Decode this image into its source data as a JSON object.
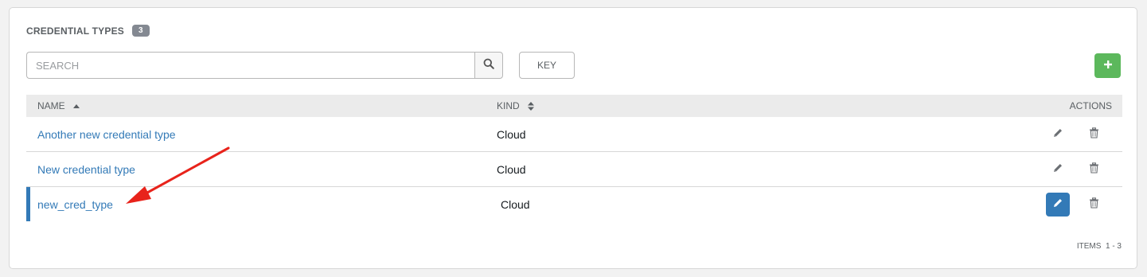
{
  "header": {
    "title": "CREDENTIAL TYPES",
    "count": "3"
  },
  "search": {
    "placeholder": "SEARCH",
    "value": ""
  },
  "toolbar": {
    "key_label": "KEY",
    "add_label": "+"
  },
  "table": {
    "columns": {
      "name": "NAME",
      "kind": "KIND",
      "actions": "ACTIONS"
    },
    "rows": [
      {
        "name": "Another new credential type",
        "kind": "Cloud",
        "selected": false
      },
      {
        "name": "New credential type",
        "kind": "Cloud",
        "selected": false
      },
      {
        "name": "new_cred_type",
        "kind": "Cloud",
        "selected": true
      }
    ]
  },
  "pagination": {
    "label": "ITEMS",
    "range": "1 - 3"
  },
  "colors": {
    "link": "#337ab7",
    "add_button": "#5cb85c",
    "selected_marker": "#337ab7",
    "annotation_arrow": "#e8231b"
  },
  "icons": {
    "search": "search-icon",
    "edit": "pencil-icon",
    "delete": "trash-icon",
    "sort_asc": "caret-up-icon",
    "sort_both": "sort-icon"
  }
}
